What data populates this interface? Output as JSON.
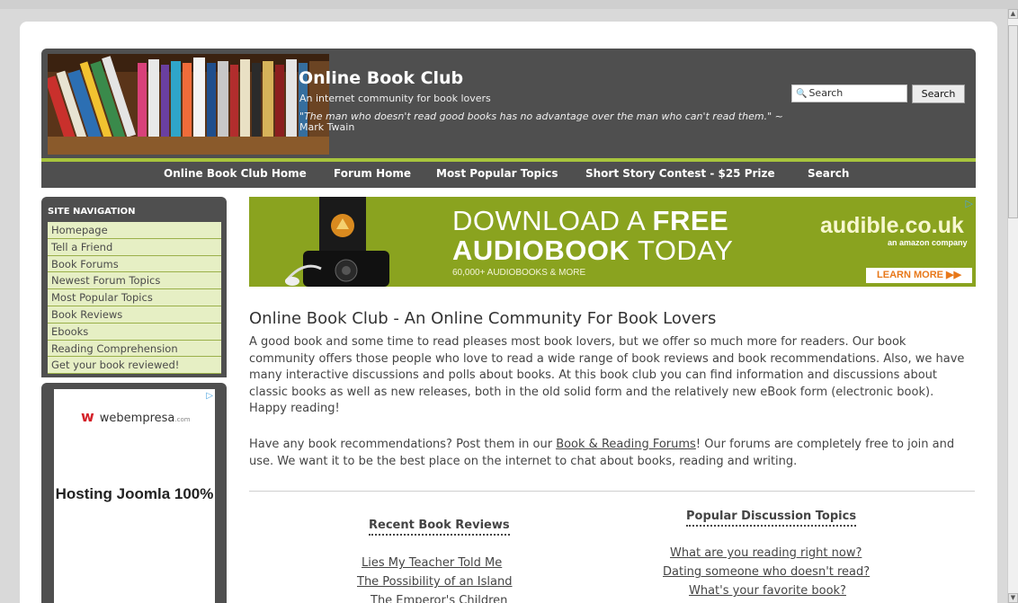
{
  "header": {
    "site_title": "Online Book Club",
    "tagline": "An internet community for book lovers",
    "quote": "\"The man who doesn't read good books has no advantage over the man who can't read them.\"",
    "quote_author": "~ Mark Twain",
    "search_placeholder": "Search",
    "search_button": "Search",
    "nav": [
      "Online Book Club Home",
      "Forum Home",
      "Most Popular Topics",
      "Short Story Contest - $25 Prize",
      "Search"
    ]
  },
  "sidebar": {
    "title": "SITE NAVIGATION",
    "items": [
      "Homepage",
      "Tell a Friend",
      "Book Forums",
      "Newest Forum Topics",
      "Most Popular Topics",
      "Book Reviews",
      "Ebooks",
      "Reading Comprehension",
      "Get your book reviewed!"
    ],
    "ad": {
      "brand": "webempresa",
      "brand_suffix": ".com",
      "headline": "Hosting Joomla 100%"
    }
  },
  "ad_banner": {
    "line1_a": "DOWNLOAD A ",
    "line1_b": "FREE",
    "line2_a": "AUDIOBOOK",
    "line2_b": " TODAY",
    "small": "60,000+ AUDIOBOOKS & MORE",
    "brand": "audible.co.uk",
    "brand_sub": "an amazon company",
    "cta": "LEARN MORE ▶▶"
  },
  "main": {
    "title": "Online Book Club - An Online Community For Book Lovers",
    "para1": "A good book and some time to read pleases most book lovers, but we offer so much more for readers. Our book community offers those people who love to read a wide range of book reviews and book recommendations. Also, we have many interactive discussions and polls about books. At this book club you can find information and discussions about classic books as well as new releases, both in the old solid form and the relatively new eBook form (electronic book). Happy reading!",
    "para2_a": "Have any book recommendations? Post them in our ",
    "para2_link": "Book & Reading Forums",
    "para2_b": "! Our forums are completely free to join and use. We want it to be the best place on the internet to chat about books, reading and writing.",
    "recent_title": "Recent Book Reviews",
    "recent": [
      "Lies My Teacher Told Me",
      "The Possibility of an Island",
      "The Emperor's Children"
    ],
    "popular_title": "Popular Discussion Topics",
    "popular": [
      "What are you reading right now?",
      "Dating someone who doesn't read?",
      "What's your favorite book?"
    ]
  }
}
